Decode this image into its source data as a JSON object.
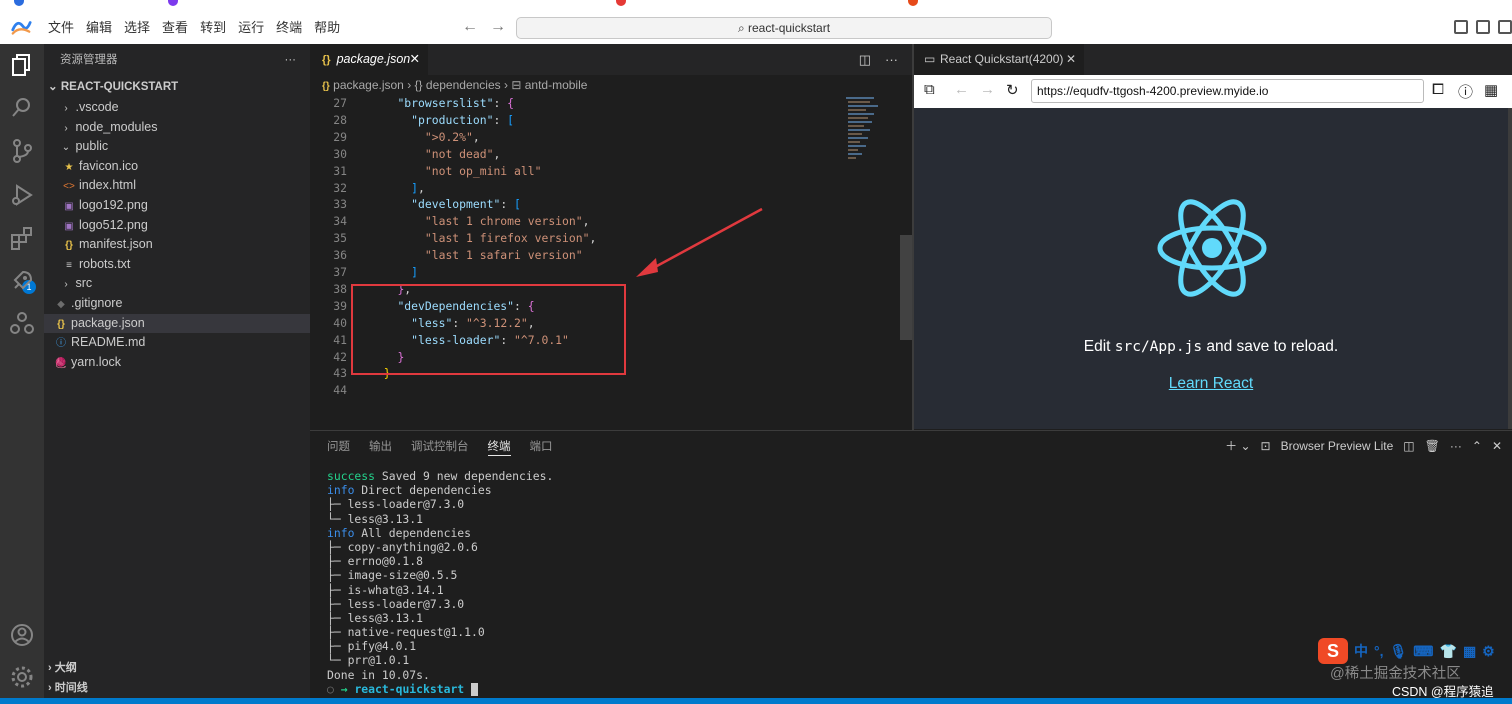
{
  "titlebar": {
    "menu": [
      "文件",
      "编辑",
      "选择",
      "查看",
      "转到",
      "运行",
      "终端",
      "帮助"
    ],
    "search": "react-quickstart"
  },
  "explorer": {
    "title": "资源管理器",
    "more": "···",
    "project": "REACT-QUICKSTART",
    "items": [
      {
        "label": ".vscode",
        "chevron": "›",
        "icon": ""
      },
      {
        "label": "node_modules",
        "chevron": "›",
        "icon": ""
      },
      {
        "label": "public",
        "chevron": "⌄",
        "icon": ""
      },
      {
        "label": "favicon.ico",
        "chevron": "",
        "icon": "★"
      },
      {
        "label": "index.html",
        "chevron": "",
        "icon": "<>"
      },
      {
        "label": "logo192.png",
        "chevron": "",
        "icon": "▣"
      },
      {
        "label": "logo512.png",
        "chevron": "",
        "icon": "▣"
      },
      {
        "label": "manifest.json",
        "chevron": "",
        "icon": "{}"
      },
      {
        "label": "robots.txt",
        "chevron": "",
        "icon": "≡"
      },
      {
        "label": "src",
        "chevron": "›",
        "icon": ""
      },
      {
        "label": ".gitignore",
        "chevron": "",
        "icon": "◆"
      },
      {
        "label": "package.json",
        "chevron": "",
        "icon": "{}"
      },
      {
        "label": "README.md",
        "chevron": "",
        "icon": "ⓘ"
      },
      {
        "label": "yarn.lock",
        "chevron": "",
        "icon": "🧶"
      }
    ],
    "outline": "大纲",
    "timeline": "时间线",
    "extensions_badge": "1"
  },
  "editor": {
    "tab_icon": "{}",
    "tab_label": "package.json",
    "breadcrumb": {
      "file": "package.json",
      "sep1": "›",
      "node1": "dependencies",
      "sep2": "›",
      "node2": "antd-mobile"
    },
    "lines": [
      {
        "n": "27",
        "html": "    <span class=\"k\">\"browserslist\"</span><span class=\"p\">: </span><span class=\"b1\">{</span>"
      },
      {
        "n": "28",
        "html": "      <span class=\"k\">\"production\"</span><span class=\"p\">: </span><span class=\"b2\">[</span>"
      },
      {
        "n": "29",
        "html": "        <span class=\"s\">\"&gt;0.2%\"</span><span class=\"p\">,</span>"
      },
      {
        "n": "30",
        "html": "        <span class=\"s\">\"not dead\"</span><span class=\"p\">,</span>"
      },
      {
        "n": "31",
        "html": "        <span class=\"s\">\"not op_mini all\"</span>"
      },
      {
        "n": "32",
        "html": "      <span class=\"b2\">]</span><span class=\"p\">,</span>"
      },
      {
        "n": "33",
        "html": "      <span class=\"k\">\"development\"</span><span class=\"p\">: </span><span class=\"b2\">[</span>"
      },
      {
        "n": "34",
        "html": "        <span class=\"s\">\"last 1 chrome version\"</span><span class=\"p\">,</span>"
      },
      {
        "n": "35",
        "html": "        <span class=\"s\">\"last 1 firefox version\"</span><span class=\"p\">,</span>"
      },
      {
        "n": "36",
        "html": "        <span class=\"s\">\"last 1 safari version\"</span>"
      },
      {
        "n": "37",
        "html": "      <span class=\"b2\">]</span>"
      },
      {
        "n": "38",
        "html": "    <span class=\"b1\">}</span><span class=\"p\">,</span>"
      },
      {
        "n": "39",
        "html": "    <span class=\"k\">\"devDependencies\"</span><span class=\"p\">: </span><span class=\"b1\">{</span>"
      },
      {
        "n": "40",
        "html": "      <span class=\"k\">\"less\"</span><span class=\"p\">: </span><span class=\"s\">\"^3.12.2\"</span><span class=\"p\">,</span>"
      },
      {
        "n": "41",
        "html": "      <span class=\"k\">\"less-loader\"</span><span class=\"p\">: </span><span class=\"s\">\"^7.0.1\"</span>"
      },
      {
        "n": "42",
        "html": "    <span class=\"b1\">}</span>"
      },
      {
        "n": "43",
        "html": "  <span class=\"b0\">}</span>"
      },
      {
        "n": "44",
        "html": ""
      }
    ]
  },
  "preview": {
    "tab_label": "React Quickstart(4200)",
    "url": "https://equdfv-ttgosh-4200.preview.myide.io",
    "edit_prefix": "Edit ",
    "edit_code": "src/App.js",
    "edit_suffix": " and save to reload.",
    "learn": "Learn React",
    "react_color": "#61dafb",
    "bg_color": "#282c34"
  },
  "panel": {
    "tabs": [
      "问题",
      "输出",
      "调试控制台",
      "终端",
      "端口"
    ],
    "active_tab": "终端",
    "right_label": "Browser Preview Lite",
    "terminal": [
      {
        "a": "success",
        "ac": "g",
        "b": " Saved 9 new dependencies."
      },
      {
        "a": "info",
        "ac": "bl",
        "b": " Direct dependencies"
      },
      {
        "a": "",
        "ac": "",
        "b": "├─ less-loader@7.3.0"
      },
      {
        "a": "",
        "ac": "",
        "b": "└─ less@3.13.1"
      },
      {
        "a": "info",
        "ac": "bl",
        "b": " All dependencies"
      },
      {
        "a": "",
        "ac": "",
        "b": "├─ copy-anything@2.0.6"
      },
      {
        "a": "",
        "ac": "",
        "b": "├─ errno@0.1.8"
      },
      {
        "a": "",
        "ac": "",
        "b": "├─ image-size@0.5.5"
      },
      {
        "a": "",
        "ac": "",
        "b": "├─ is-what@3.14.1"
      },
      {
        "a": "",
        "ac": "",
        "b": "├─ less-loader@7.3.0"
      },
      {
        "a": "",
        "ac": "",
        "b": "├─ less@3.13.1"
      },
      {
        "a": "",
        "ac": "",
        "b": "├─ native-request@1.1.0"
      },
      {
        "a": "",
        "ac": "",
        "b": "├─ pify@4.0.1"
      },
      {
        "a": "",
        "ac": "",
        "b": "└─ prr@1.0.1"
      },
      {
        "a": "",
        "ac": "",
        "b": "Done in 10.07s."
      }
    ],
    "prompt_arrow": "→",
    "prompt_dir": "react-quickstart"
  },
  "overlay": {
    "ime_zh": "中",
    "watermark": "@稀土掘金技术社区",
    "csdn": "CSDN @程序猿追"
  }
}
